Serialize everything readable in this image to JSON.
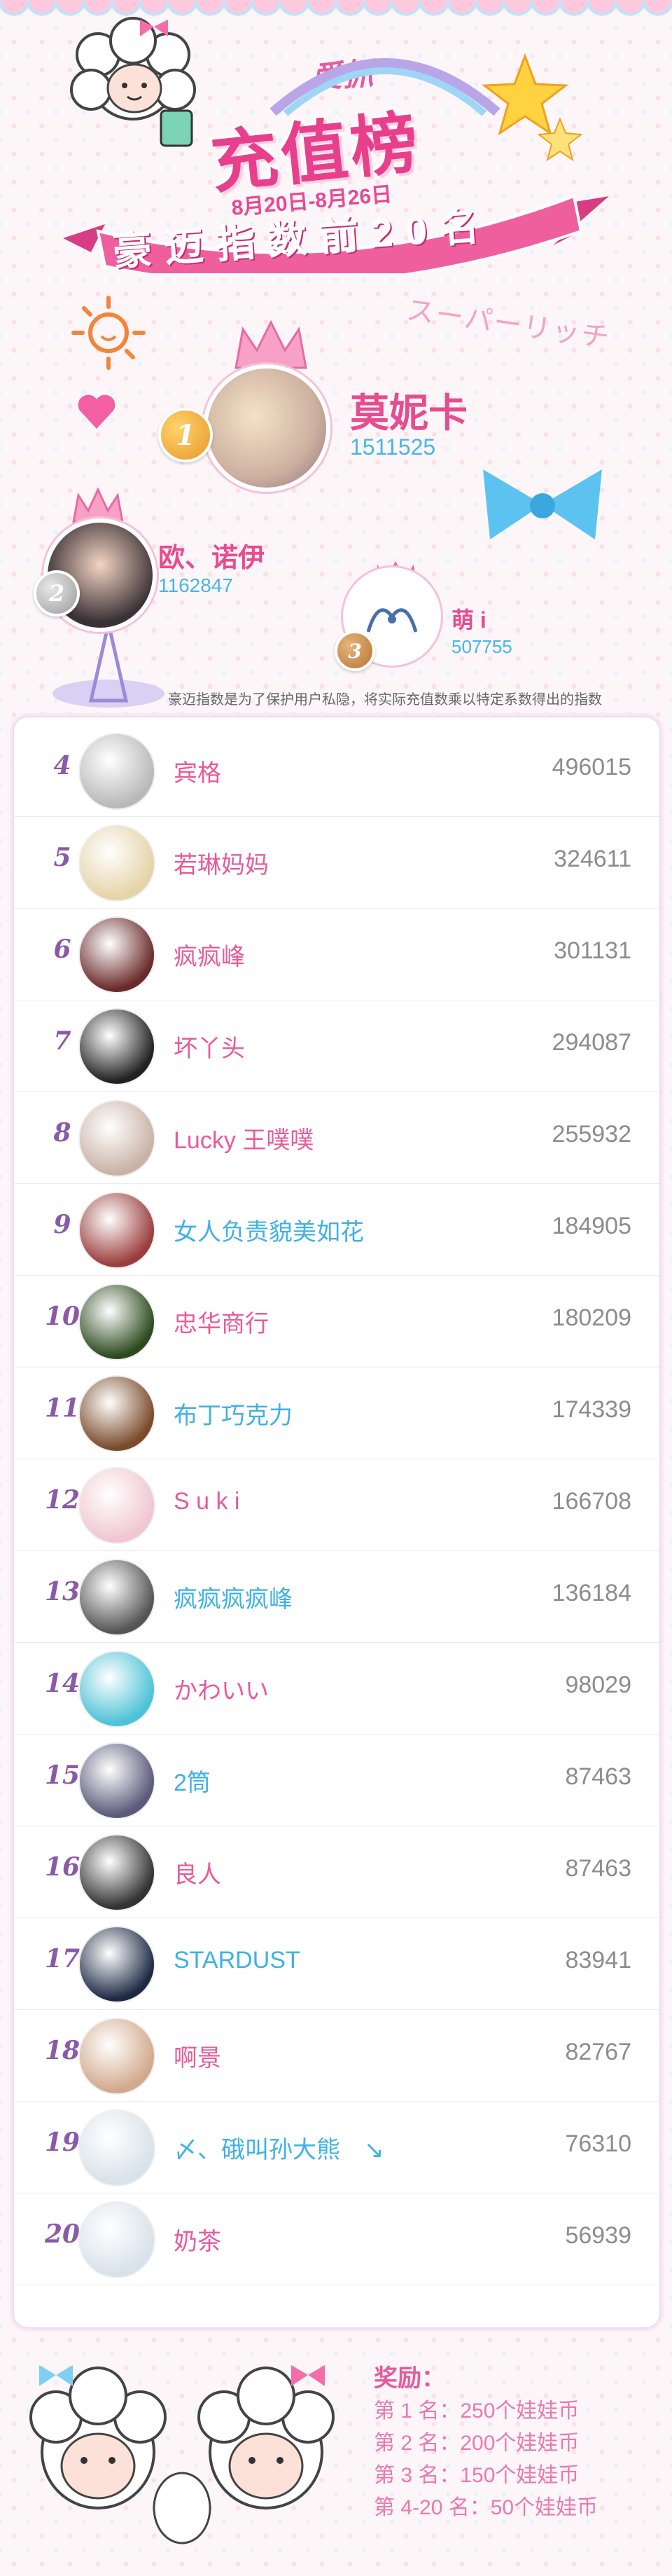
{
  "header": {
    "title_small": "爱抓",
    "title_big": "充值榜",
    "date_range": "8月20日-8月26日",
    "ribbon": "豪迈指数前20名",
    "deco": "スーパーリッチ"
  },
  "top3": [
    {
      "rank": "1",
      "name": "莫妮卡",
      "value": "1511525"
    },
    {
      "rank": "2",
      "name": "欧、诺伊",
      "value": "1162847"
    },
    {
      "rank": "3",
      "name": "萌 i",
      "value": "507755"
    }
  ],
  "notice": "豪迈指数是为了保护用户私隐，将实际充值数乘以特定系数得出的指数",
  "rows": [
    {
      "rank": "4",
      "name": "宾格",
      "value": "496015",
      "color": "pink",
      "avatar": "#b9b9b9"
    },
    {
      "rank": "5",
      "name": "若琳妈妈",
      "value": "324611",
      "color": "pink",
      "avatar": "#e6d3a8"
    },
    {
      "rank": "6",
      "name": "疯疯峰",
      "value": "301131",
      "color": "pink",
      "avatar": "#6a2a2a"
    },
    {
      "rank": "7",
      "name": "坏丫头",
      "value": "294087",
      "color": "pink",
      "avatar": "#222222"
    },
    {
      "rank": "8",
      "name": "Lucky 王噗噗",
      "value": "255932",
      "color": "pink",
      "avatar": "#c9b3a6"
    },
    {
      "rank": "9",
      "name": "女人负责貌美如花",
      "value": "184905",
      "color": "blue",
      "avatar": "#9a3d3d"
    },
    {
      "rank": "10",
      "name": "忠华商行",
      "value": "180209",
      "color": "pink",
      "avatar": "#2d4a1e"
    },
    {
      "rank": "11",
      "name": "布丁巧克力",
      "value": "174339",
      "color": "blue",
      "avatar": "#7a4a2a"
    },
    {
      "rank": "12",
      "name": "S u k i",
      "value": "166708",
      "color": "pink",
      "avatar": "#f0c6d2"
    },
    {
      "rank": "13",
      "name": "疯疯疯疯峰",
      "value": "136184",
      "color": "blue",
      "avatar": "#555555"
    },
    {
      "rank": "14",
      "name": "かわいい",
      "value": "98029",
      "color": "pink",
      "avatar": "#4ec2d6"
    },
    {
      "rank": "15",
      "name": "2筒",
      "value": "87463",
      "color": "blue",
      "avatar": "#5a5a7a"
    },
    {
      "rank": "16",
      "name": "良人",
      "value": "87463",
      "color": "pink",
      "avatar": "#333333"
    },
    {
      "rank": "17",
      "name": "STARDUST",
      "value": "83941",
      "color": "blue",
      "avatar": "#1e2a44"
    },
    {
      "rank": "18",
      "name": "啊景",
      "value": "82767",
      "color": "pink",
      "avatar": "#d2a98c"
    },
    {
      "rank": "19",
      "name": "〆、硪叫孙大熊　↘",
      "value": "76310",
      "color": "blue",
      "avatar": "#d8e2ea"
    },
    {
      "rank": "20",
      "name": "奶茶",
      "value": "56939",
      "color": "pink",
      "avatar": "#d8e2ea"
    }
  ],
  "reward": {
    "title": "奖励：",
    "lines": [
      "第 1 名：250个娃娃币",
      "第 2 名：200个娃娃币",
      "第 3 名：150个娃娃币",
      "第 4-20 名：50个娃娃币"
    ]
  },
  "colors": {
    "pink": "#e85a9b",
    "blue": "#3fb1e5",
    "rank": "#8a5aa8"
  }
}
